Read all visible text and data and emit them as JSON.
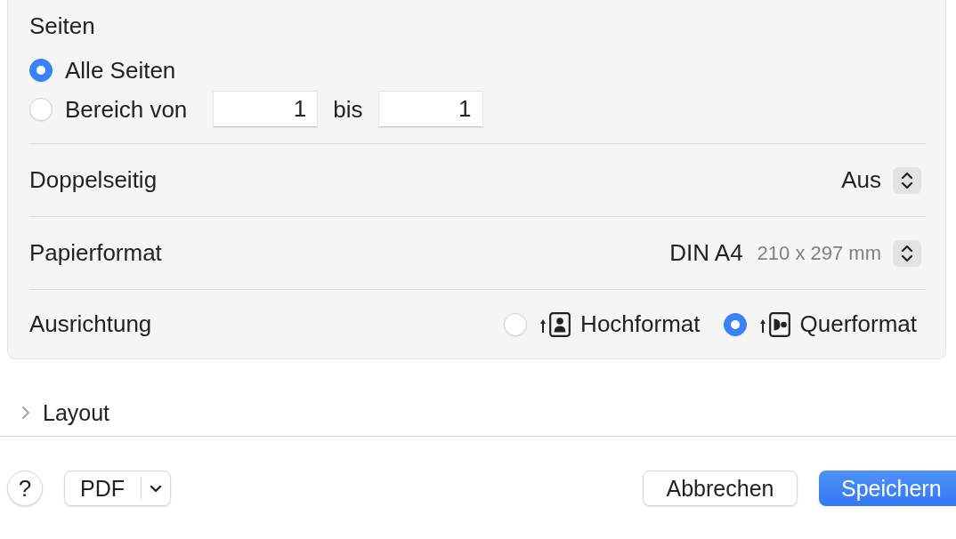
{
  "pages": {
    "label": "Seiten",
    "options": [
      {
        "label": "Alle Seiten",
        "kind": "all",
        "selected": true
      },
      {
        "label": "Bereich von",
        "kind": "range",
        "selected": false
      }
    ],
    "range": {
      "from": "1",
      "separator": "bis",
      "to": "1"
    }
  },
  "settings": [
    {
      "label": "Doppelseitig",
      "kind": "popup",
      "value": "Aus"
    },
    {
      "label": "Papierformat",
      "kind": "popup",
      "value": "DIN A4",
      "detail": "210 x 297 mm"
    },
    {
      "label": "Ausrichtung",
      "kind": "radios",
      "options": [
        {
          "label": "Hochformat",
          "kind": "portrait",
          "selected": false
        },
        {
          "label": "Querformat",
          "kind": "landscape",
          "selected": true
        }
      ]
    }
  ],
  "layout_section": {
    "label": "Layout",
    "expanded": false
  },
  "footer": {
    "help_button": "?",
    "pdf_button": "PDF",
    "buttons": [
      {
        "label": "Abbrechen",
        "kind": "secondary"
      },
      {
        "label": "Speichern",
        "kind": "primary"
      }
    ]
  }
}
